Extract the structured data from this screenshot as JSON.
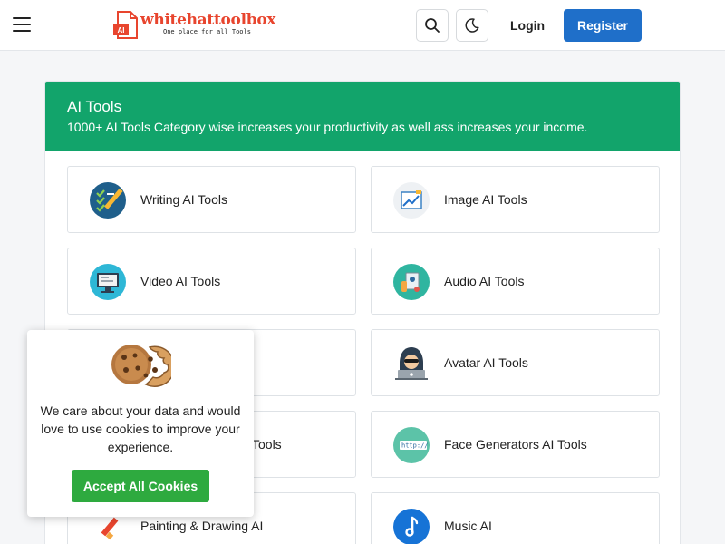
{
  "header": {
    "logo": {
      "name": "whitehattoolbox",
      "tagline": "One place for all Tools",
      "badge_text": "AI"
    },
    "menu_icon": "hamburger-menu-icon",
    "search_icon": "search-icon",
    "theme_icon": "moon-icon",
    "login_label": "Login",
    "register_label": "Register"
  },
  "section": {
    "title": "AI Tools",
    "subtitle": "1000+ AI Tools Category wise increases your productivity as well ass increases your income.",
    "tiles": [
      {
        "label": "Writing AI Tools",
        "icon": "writing-checklist-icon"
      },
      {
        "label": "Image AI Tools",
        "icon": "image-chart-icon"
      },
      {
        "label": "Video AI Tools",
        "icon": "monitor-icon"
      },
      {
        "label": "Audio AI Tools",
        "icon": "audio-icon"
      },
      {
        "label": "",
        "icon": ""
      },
      {
        "label": "Avatar AI Tools",
        "icon": "hacker-avatar-icon"
      },
      {
        "label": "Tools",
        "icon": ""
      },
      {
        "label": "Face Generators AI Tools",
        "icon": "browser-url-icon"
      },
      {
        "label": "Painting & Drawing AI",
        "icon": "paintbrush-icon"
      },
      {
        "label": "Music AI",
        "icon": "music-note-icon"
      }
    ]
  },
  "cookie_banner": {
    "icon": "cookie-icon",
    "message": "We care about your data and would love to use cookies to improve your experience.",
    "accept_label": "Accept All Cookies"
  },
  "colors": {
    "header_green": "#12a46b",
    "register_blue": "#1f6fc9",
    "cookie_green": "#2eaa3f",
    "logo_red": "#e8452e"
  }
}
